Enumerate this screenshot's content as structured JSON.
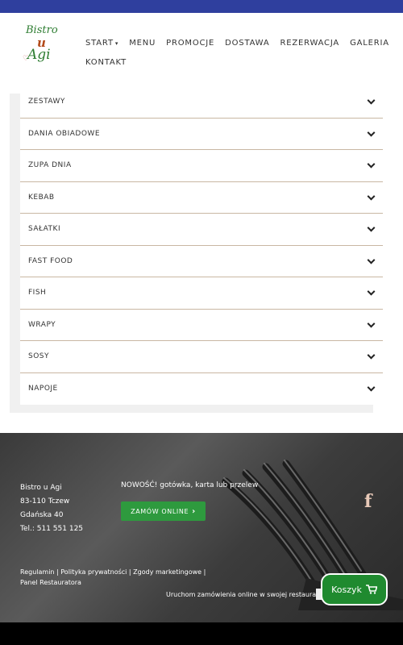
{
  "logo": {
    "line1": "Bistro",
    "line2": "u",
    "line3": "Agi"
  },
  "nav": {
    "row1": [
      "START",
      "MENU",
      "PROMOCJE",
      "DOSTAWA",
      "REZERWACJA",
      "GALERIA"
    ],
    "row2": [
      "KONTAKT"
    ],
    "start_caret": "▾"
  },
  "menu_categories": [
    "ZESTAWY",
    "DANIA OBIADOWE",
    "ZUPA DNIA",
    "KEBAB",
    "SAŁATKI",
    "FAST FOOD",
    "FISH",
    "WRAPY",
    "SOSY",
    "NAPOJE"
  ],
  "footer": {
    "address": [
      "Bistro u Agi",
      "83-110 Tczew",
      "Gdańska 40",
      "Tel.: 511 551 125"
    ],
    "news": "NOWOŚĆ! gotówka, karta lub przelew",
    "order_button": "ZAMÓW ONLINE",
    "links": "Regulamin | Polityka prywatności | Zgody marketingowe | Panel Restauratora",
    "promo": "Uruchom zamówienia online w swojej restauracji!",
    "facebook_icon": "f"
  },
  "cart": {
    "label": "Koszyk"
  },
  "colors": {
    "topbar": "#2f3f9e",
    "green": "#2e9a3e",
    "cart": "#1f8a2f"
  }
}
